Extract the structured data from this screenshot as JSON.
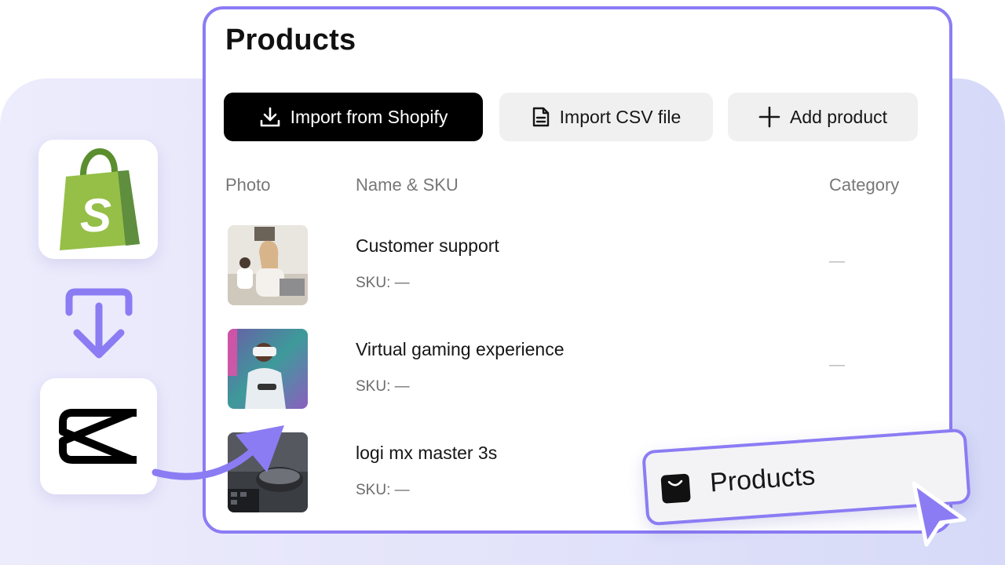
{
  "page": {
    "title": "Products"
  },
  "toolbar": {
    "import_shopify_label": "Import from Shopify",
    "import_csv_label": "Import CSV file",
    "add_product_label": "Add product"
  },
  "table": {
    "columns": [
      "Photo",
      "Name & SKU",
      "Category"
    ],
    "rows": [
      {
        "name": "Customer support",
        "sku": "SKU: —",
        "category": "—",
        "photo": "office-woman-headset"
      },
      {
        "name": "Virtual gaming experience",
        "sku": "SKU: —",
        "category": "—",
        "photo": "vr-headset-man"
      },
      {
        "name": "logi mx master 3s",
        "sku": "SKU: —",
        "category": "",
        "photo": "mouse-and-keyboard"
      }
    ]
  },
  "floating_tab": {
    "label": "Products",
    "icon": "shopping-bag-icon"
  },
  "icons": {
    "shopify": "shopify-logo-icon",
    "capcut": "capcut-logo-icon",
    "transfer": "arrow-down-icon",
    "cursor": "cursor-pointer-icon"
  },
  "colors": {
    "accent": "#8b7cf4",
    "primary_button": "#000000",
    "secondary_button": "#f0f0f1",
    "shopify_green": "#95bf47"
  }
}
